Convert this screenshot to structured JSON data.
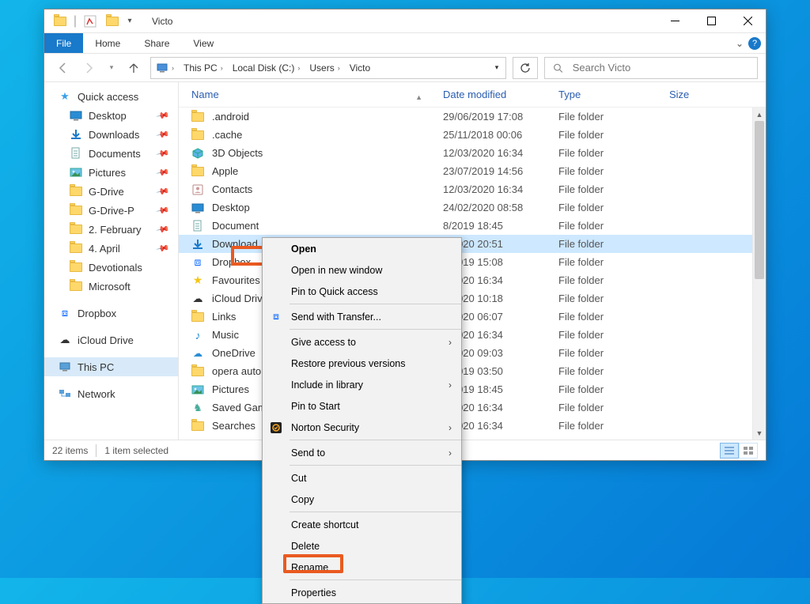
{
  "window": {
    "title": "Victo",
    "controls": {
      "min": "–",
      "max": "▢",
      "close": "✕"
    }
  },
  "ribbon": {
    "file": "File",
    "tabs": [
      "Home",
      "Share",
      "View"
    ]
  },
  "breadcrumb": [
    "This PC",
    "Local Disk (C:)",
    "Users",
    "Victo"
  ],
  "search": {
    "placeholder": "Search Victo"
  },
  "nav": {
    "quick_access": "Quick access",
    "items": [
      {
        "label": "Desktop",
        "pin": true,
        "icon": "desktop"
      },
      {
        "label": "Downloads",
        "pin": true,
        "icon": "download"
      },
      {
        "label": "Documents",
        "pin": true,
        "icon": "document"
      },
      {
        "label": "Pictures",
        "pin": true,
        "icon": "pictures"
      },
      {
        "label": "G-Drive",
        "pin": true,
        "icon": "folder"
      },
      {
        "label": "G-Drive-P",
        "pin": true,
        "icon": "folder"
      },
      {
        "label": "2. February",
        "pin": true,
        "icon": "folder"
      },
      {
        "label": "4. April",
        "pin": true,
        "icon": "folder"
      },
      {
        "label": "Devotionals",
        "pin": false,
        "icon": "folder"
      },
      {
        "label": "Microsoft",
        "pin": false,
        "icon": "folder"
      }
    ],
    "dropbox": "Dropbox",
    "icloud": "iCloud Drive",
    "thispc": "This PC",
    "network": "Network"
  },
  "columns": {
    "name": "Name",
    "date": "Date modified",
    "type": "Type",
    "size": "Size"
  },
  "rows": [
    {
      "name": ".android",
      "date": "29/06/2019 17:08",
      "type": "File folder",
      "icon": "folder"
    },
    {
      "name": ".cache",
      "date": "25/11/2018 00:06",
      "type": "File folder",
      "icon": "folder"
    },
    {
      "name": "3D Objects",
      "date": "12/03/2020 16:34",
      "type": "File folder",
      "icon": "3d"
    },
    {
      "name": "Apple",
      "date": "23/07/2019 14:56",
      "type": "File folder",
      "icon": "folder"
    },
    {
      "name": "Contacts",
      "date": "12/03/2020 16:34",
      "type": "File folder",
      "icon": "contacts"
    },
    {
      "name": "Desktop",
      "date": "24/02/2020 08:58",
      "type": "File folder",
      "icon": "desktop"
    },
    {
      "name": "Document",
      "date_suffix": "8/2019 18:45",
      "type": "File folder",
      "icon": "document",
      "cut": true
    },
    {
      "name": "Download",
      "date_suffix": "5/2020 20:51",
      "type": "File folder",
      "icon": "download",
      "cut": true,
      "sel": true,
      "hl": true
    },
    {
      "name": "Dropbox",
      "date_suffix": "1/2019 15:08",
      "type": "File folder",
      "icon": "dropbox",
      "cut": true
    },
    {
      "name": "Favourites",
      "date_suffix": "3/2020 16:34",
      "type": "File folder",
      "icon": "fav",
      "cut": true
    },
    {
      "name": "iCloud Driv",
      "date_suffix": "4/2020 10:18",
      "type": "File folder",
      "icon": "icloud",
      "cut": true
    },
    {
      "name": "Links",
      "date_suffix": "3/2020 06:07",
      "type": "File folder",
      "icon": "links",
      "cut": true
    },
    {
      "name": "Music",
      "date_suffix": "3/2020 16:34",
      "type": "File folder",
      "icon": "music",
      "cut": true
    },
    {
      "name": "OneDrive",
      "date_suffix": "2/2020 09:03",
      "type": "File folder",
      "icon": "onedrive",
      "cut": true
    },
    {
      "name": "opera auto",
      "date_suffix": "3/2019 03:50",
      "type": "File folder",
      "icon": "folder",
      "cut": true
    },
    {
      "name": "Pictures",
      "date_suffix": "8/2019 18:45",
      "type": "File folder",
      "icon": "pictures",
      "cut": true
    },
    {
      "name": "Saved Gam",
      "date_suffix": "3/2020 16:34",
      "type": "File folder",
      "icon": "games",
      "cut": true
    },
    {
      "name": "Searches",
      "date_suffix": "3/2020 16:34",
      "type": "File folder",
      "icon": "search",
      "cut": true
    }
  ],
  "status": {
    "items": "22 items",
    "selected": "1 item selected"
  },
  "ctx": {
    "open": "Open",
    "open_new": "Open in new window",
    "pin_qa": "Pin to Quick access",
    "send_transfer": "Send with Transfer...",
    "give_access": "Give access to",
    "restore": "Restore previous versions",
    "include_lib": "Include in library",
    "pin_start": "Pin to Start",
    "norton": "Norton Security",
    "send_to": "Send to",
    "cut": "Cut",
    "copy": "Copy",
    "shortcut": "Create shortcut",
    "delete": "Delete",
    "rename": "Rename",
    "properties": "Properties"
  }
}
